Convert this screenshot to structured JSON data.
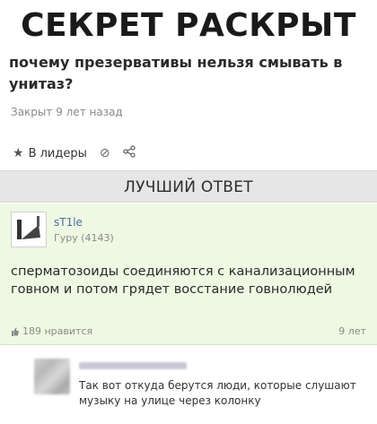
{
  "meme_title": "СЕКРЕТ РАСКРЫТ",
  "question": {
    "text": "почему презервативы нельзя смывать в унитаз?",
    "closed_status": "Закрыт 9 лет назад"
  },
  "actions": {
    "leaders_label": "В лидеры",
    "star_icon": "★",
    "block_icon": "⊘",
    "share_icon": "share-icon"
  },
  "best_answer": {
    "header": "ЛУЧШИЙ ОТВЕТ",
    "username": "sT1le",
    "rank": "Гуру (4143)",
    "text": "сперматозоиды соединяются с канализационным говном и потом грядет восстание говнолюдей",
    "likes": "189 нравится",
    "age": "9 лет"
  },
  "comment": {
    "text": "Так вот откуда берутся люди, которые слушают музыку на улице через колонку"
  }
}
